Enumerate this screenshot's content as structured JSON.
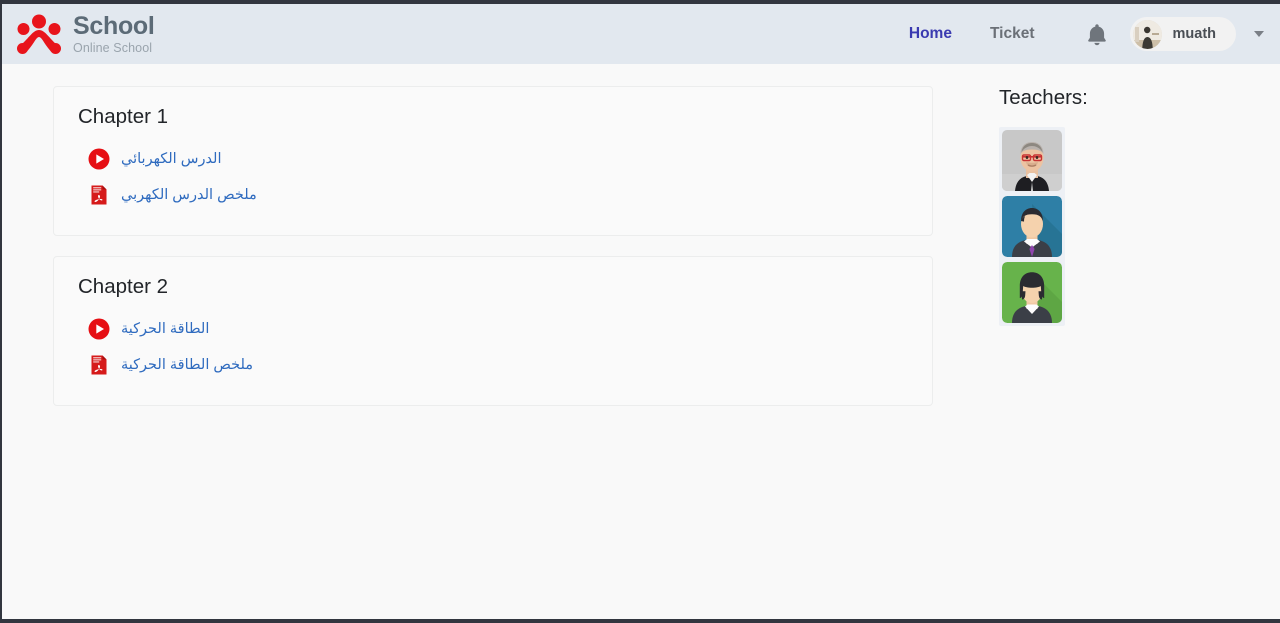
{
  "brand": {
    "title": "School",
    "subtitle": "Online School",
    "logo_icon": "school-logo-icon",
    "logo_color": "#e8141b"
  },
  "navbar": {
    "background": "#e2e8ef",
    "links": [
      {
        "label": "Home",
        "active": true,
        "color": "#3a3ab0"
      },
      {
        "label": "Ticket",
        "active": false,
        "color": "#6b7077"
      }
    ],
    "notifications_icon": "bell-icon",
    "user": {
      "name": "muath",
      "avatar_icon": "user-avatar",
      "caret_icon": "chevron-down-icon"
    }
  },
  "main": {
    "chapters": [
      {
        "title": "Chapter 1",
        "resources": [
          {
            "label": "الدرس الكهربائي",
            "icon": "video-play-icon",
            "type": "video"
          },
          {
            "label": "ملخص الدرس الكهربي",
            "icon": "pdf-file-icon",
            "type": "pdf"
          }
        ]
      },
      {
        "title": "Chapter 2",
        "resources": [
          {
            "label": "الطاقة الحركية",
            "icon": "video-play-icon",
            "type": "video"
          },
          {
            "label": "ملخص الطاقة الحركية",
            "icon": "pdf-file-icon",
            "type": "pdf"
          }
        ]
      }
    ]
  },
  "sidebar": {
    "title": "Teachers:",
    "teachers": [
      {
        "avatar_icon": "teacher-photo-avatar",
        "background": "#c9c9c9",
        "style": "photo"
      },
      {
        "avatar_icon": "teacher-illustration-avatar-male",
        "background": "#2f7fa8",
        "style": "illustration"
      },
      {
        "avatar_icon": "teacher-illustration-avatar-female",
        "background": "#65b14a",
        "style": "illustration"
      }
    ]
  },
  "colors": {
    "page_background": "#f9f9f9",
    "card_background": "#fafafa",
    "card_border": "#eceded",
    "link_blue": "#2f6bbf",
    "accent_red": "#e8141b",
    "heading": "#222529"
  }
}
